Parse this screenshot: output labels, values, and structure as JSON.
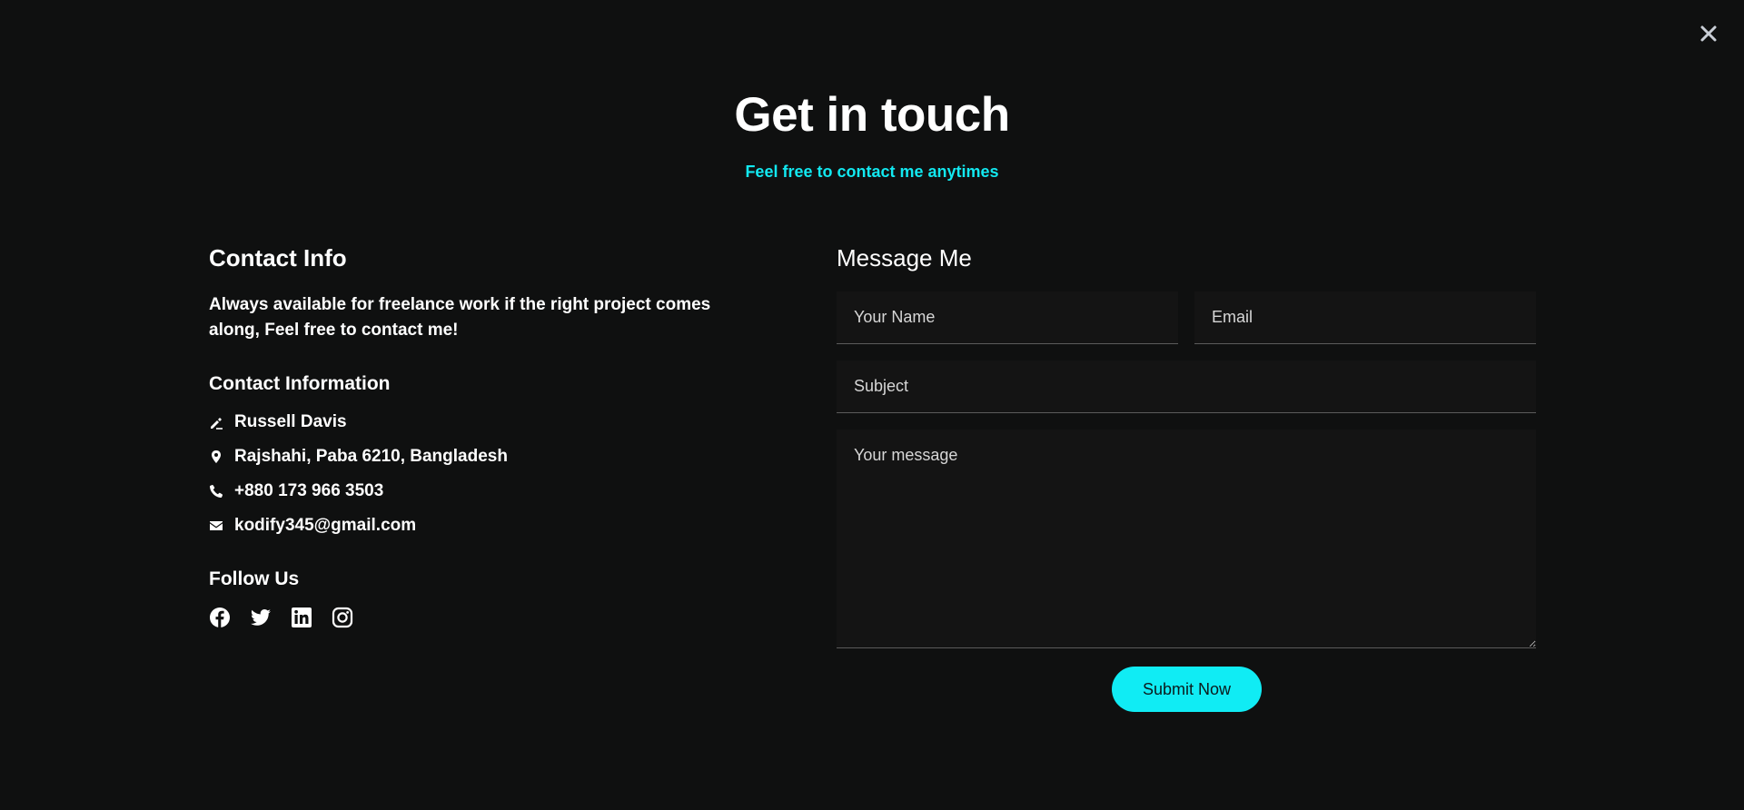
{
  "close": {
    "icon": "close-icon"
  },
  "header": {
    "title": "Get in touch",
    "subtitle": "Feel free to contact me anytimes"
  },
  "contact": {
    "heading": "Contact Info",
    "intro": "Always available for freelance work if the right project comes along, Feel free to contact me!",
    "info_heading": "Contact Information",
    "items": [
      {
        "icon": "signature-icon",
        "text": "Russell Davis"
      },
      {
        "icon": "map-pin-icon",
        "text": "Rajshahi, Paba 6210, Bangladesh"
      },
      {
        "icon": "phone-icon",
        "text": "+880 173 966 3503"
      },
      {
        "icon": "envelope-icon",
        "text": "kodify345@gmail.com"
      }
    ],
    "follow_heading": "Follow Us",
    "socials": [
      {
        "icon": "facebook-icon"
      },
      {
        "icon": "twitter-icon"
      },
      {
        "icon": "linkedin-icon"
      },
      {
        "icon": "instagram-icon"
      }
    ]
  },
  "form": {
    "heading": "Message Me",
    "name_placeholder": "Your Name",
    "email_placeholder": "Email",
    "subject_placeholder": "Subject",
    "message_placeholder": "Your message",
    "submit_label": "Submit Now"
  },
  "colors": {
    "background": "#0f1010",
    "accent": "#10ecf4",
    "field_background": "#141414",
    "text": "#ffffff"
  }
}
